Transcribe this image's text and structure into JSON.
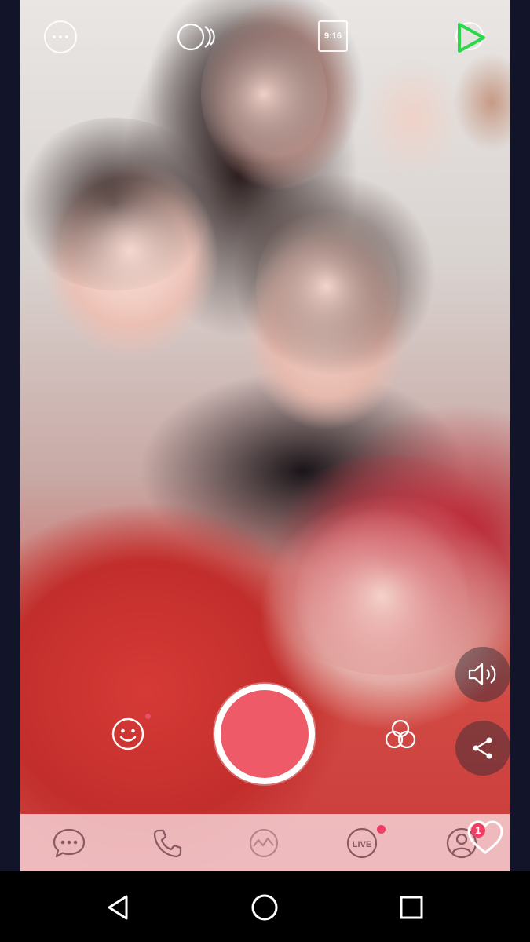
{
  "top_bar": {
    "more_icon": "more-dots-icon",
    "dual_camera_icon": "dual-camera-icon",
    "aspect_ratio_label": "9:16",
    "flip_camera_icon": "flip-camera-icon"
  },
  "side_controls": {
    "volume_icon": "volume-icon",
    "share_icon": "share-icon"
  },
  "capture": {
    "sticker_icon": "smiley-face-icon",
    "filter_icon": "filter-circles-icon",
    "shutter_color": "#ee5a68"
  },
  "tab_bar": {
    "items": [
      {
        "icon": "chat-icon"
      },
      {
        "icon": "phone-icon"
      },
      {
        "icon": "timeline-icon"
      },
      {
        "icon": "live-icon",
        "label": "LIVE"
      },
      {
        "icon": "friends-icon"
      }
    ],
    "heart_badge_count": "1"
  },
  "colors": {
    "accent": "#ee5a68",
    "badge": "#ef3e64",
    "flip_icon": "#2bd84a"
  },
  "system_nav": {
    "back_icon": "back-triangle-icon",
    "home_icon": "home-circle-icon",
    "recents_icon": "recents-square-icon"
  }
}
